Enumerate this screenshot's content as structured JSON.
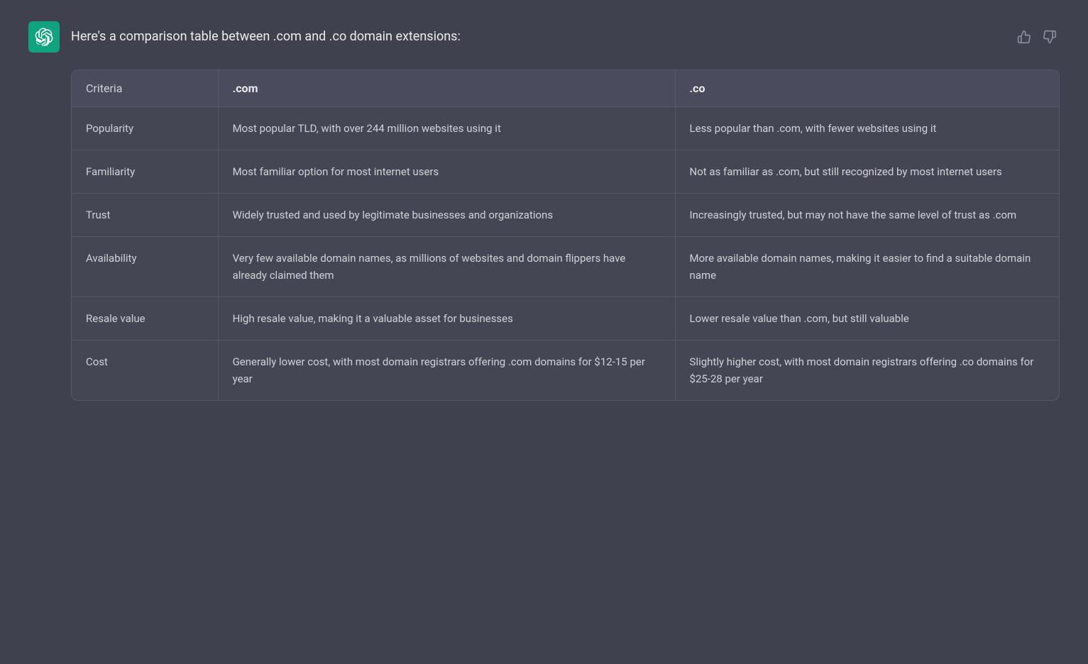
{
  "header": {
    "title": "Here's a comparison table between .com and .co domain extensions:",
    "logo_alt": "ChatGPT logo"
  },
  "feedback": {
    "thumbs_up_label": "👍",
    "thumbs_down_label": "👎"
  },
  "table": {
    "columns": [
      {
        "key": "criteria",
        "label": "Criteria"
      },
      {
        "key": "com",
        "label": ".com"
      },
      {
        "key": "co",
        "label": ".co"
      }
    ],
    "rows": [
      {
        "criteria": "Popularity",
        "com": "Most popular TLD, with over 244 million websites using it",
        "co": "Less popular than .com, with fewer websites using it"
      },
      {
        "criteria": "Familiarity",
        "com": "Most familiar option for most internet users",
        "co": "Not as familiar as .com, but still recognized by most internet users"
      },
      {
        "criteria": "Trust",
        "com": "Widely trusted and used by legitimate businesses and organizations",
        "co": "Increasingly trusted, but may not have the same level of trust as .com"
      },
      {
        "criteria": "Availability",
        "com": "Very few available domain names, as millions of websites and domain flippers have already claimed them",
        "co": "More available domain names, making it easier to find a suitable domain name"
      },
      {
        "criteria": "Resale value",
        "com": "High resale value, making it a valuable asset for businesses",
        "co": "Lower resale value than .com, but still valuable"
      },
      {
        "criteria": "Cost",
        "com": "Generally lower cost, with most domain registrars offering .com domains for $12-15 per year",
        "co": "Slightly higher cost, with most domain registrars offering .co domains for $25-28 per year"
      }
    ]
  }
}
